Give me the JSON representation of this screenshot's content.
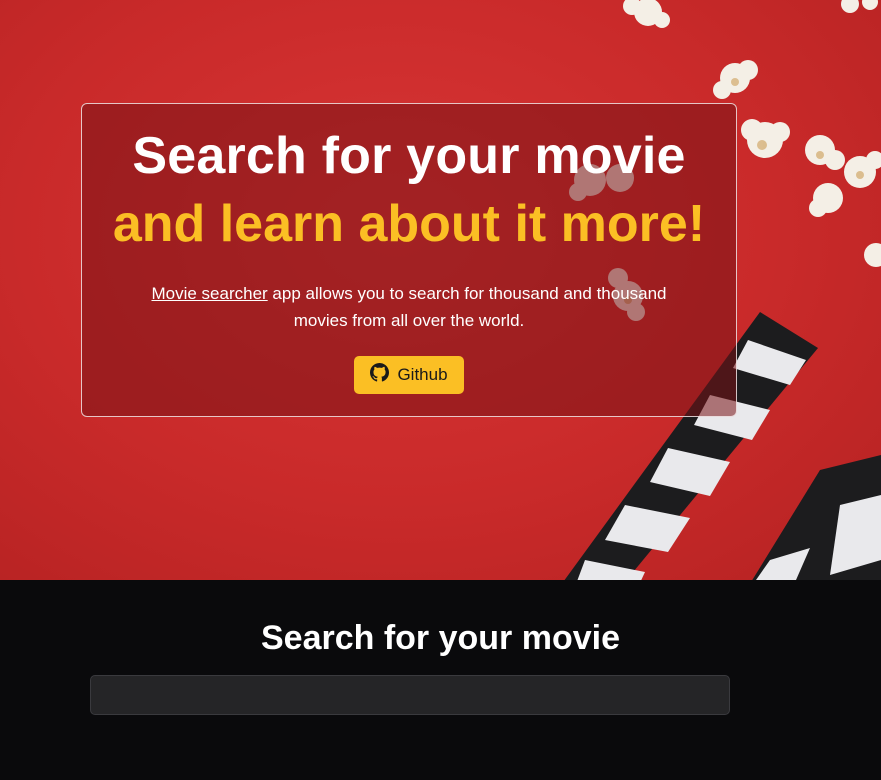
{
  "hero": {
    "title_line1": "Search for your movie",
    "title_line2": "and learn about it more!",
    "description_link": "Movie searcher",
    "description_text": " app allows you to search for thousand and thousand movies from all over the world.",
    "github_button": {
      "label": "Github",
      "icon": "github-icon"
    }
  },
  "search_section": {
    "heading": "Search for your movie",
    "input_value": "",
    "input_placeholder": ""
  },
  "colors": {
    "hero_background": "#c92a2a",
    "accent": "#fbbf24",
    "dark_background": "#0a0a0c",
    "input_background": "#252527"
  }
}
